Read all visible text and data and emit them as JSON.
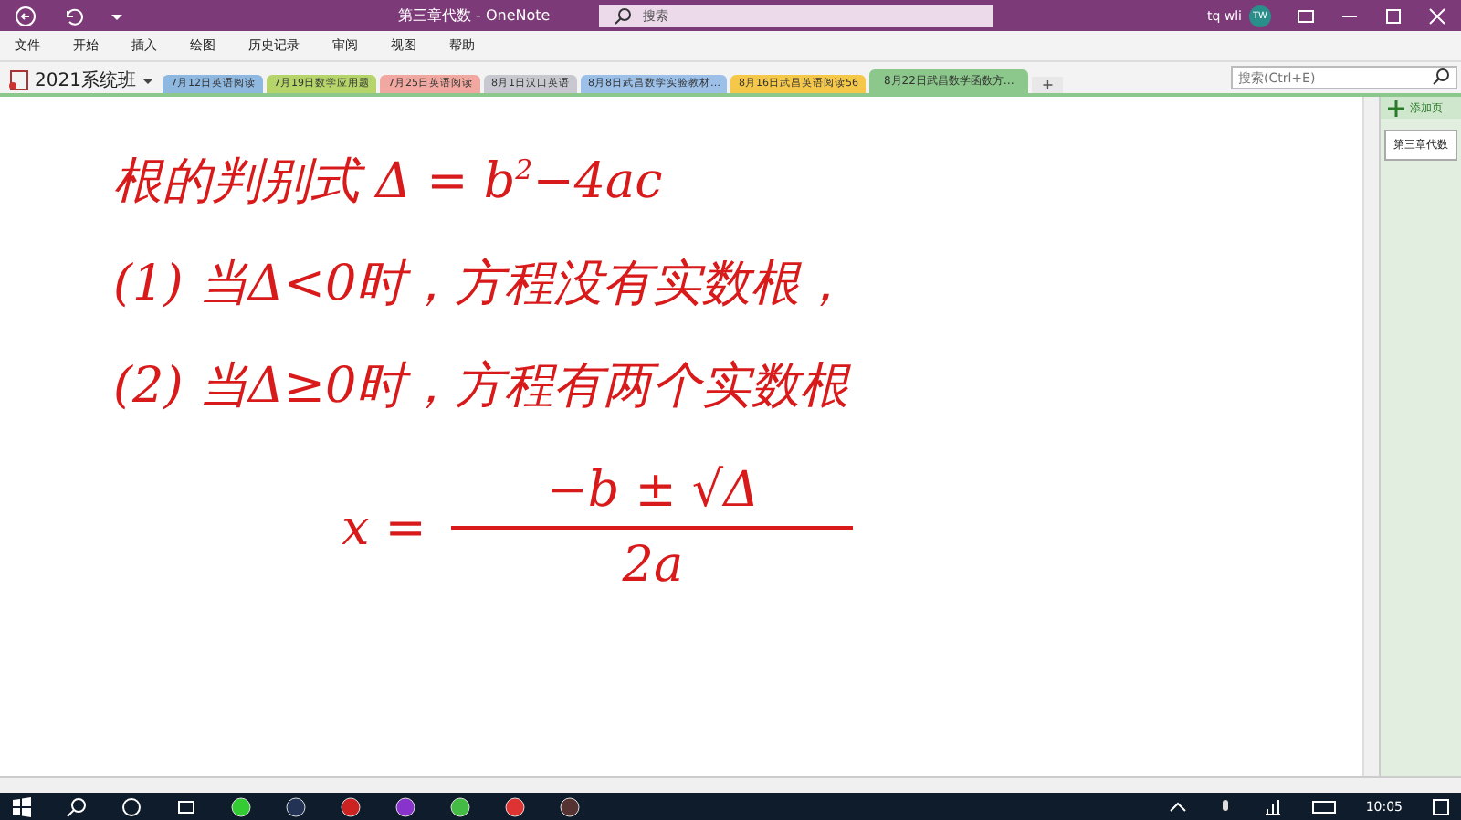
{
  "window": {
    "title": "第三章代数 - OneNote",
    "search": {
      "placeholder": "搜索"
    },
    "user": "tq wli",
    "avatar": "TW"
  },
  "menu": [
    {
      "label": "文件"
    },
    {
      "label": "开始"
    },
    {
      "label": "插入"
    },
    {
      "label": "绘图"
    },
    {
      "label": "历史记录"
    },
    {
      "label": "审阅"
    },
    {
      "label": "视图"
    },
    {
      "label": "帮助"
    }
  ],
  "notebook": {
    "name": "2021系统班"
  },
  "sections": [
    {
      "label": "7月12日英语阅读",
      "color": "#8fb8e0",
      "selected": false
    },
    {
      "label": "7月19日数学应用题",
      "color": "#b5d56b",
      "selected": false
    },
    {
      "label": "7月25日英语阅读",
      "color": "#f0a8a0",
      "selected": false
    },
    {
      "label": "8月1日汉口英语",
      "color": "#c8c8d0",
      "selected": false
    },
    {
      "label": "8月8日武昌数学实验教材…",
      "color": "#9cc0e8",
      "selected": false
    },
    {
      "label": "8月16日武昌英语阅读56",
      "color": "#f5c84a",
      "selected": false
    },
    {
      "label": "8月22日武昌数学函数方…",
      "color": "#8cc88c",
      "selected": true
    }
  ],
  "add_section": "+",
  "section_search": {
    "placeholder": "搜索(Ctrl+E)"
  },
  "ink": [
    {
      "kind": "line",
      "text": "根的判别式 Δ = b$^{2}$−4ac"
    },
    {
      "kind": "line",
      "text": "(1) 当Δ<0时，方程没有实数根，"
    },
    {
      "kind": "line",
      "text": "(2) 当Δ≥0时，方程有两个实数根"
    },
    {
      "kind": "fraction",
      "lhs": "x =",
      "numerator": "−b ± √Δ",
      "denominator": "2a"
    }
  ],
  "pages": {
    "add": "添加页",
    "items": [
      {
        "label": "第三章代数",
        "selected": true
      }
    ]
  },
  "taskbar": {
    "time": "10:05"
  }
}
